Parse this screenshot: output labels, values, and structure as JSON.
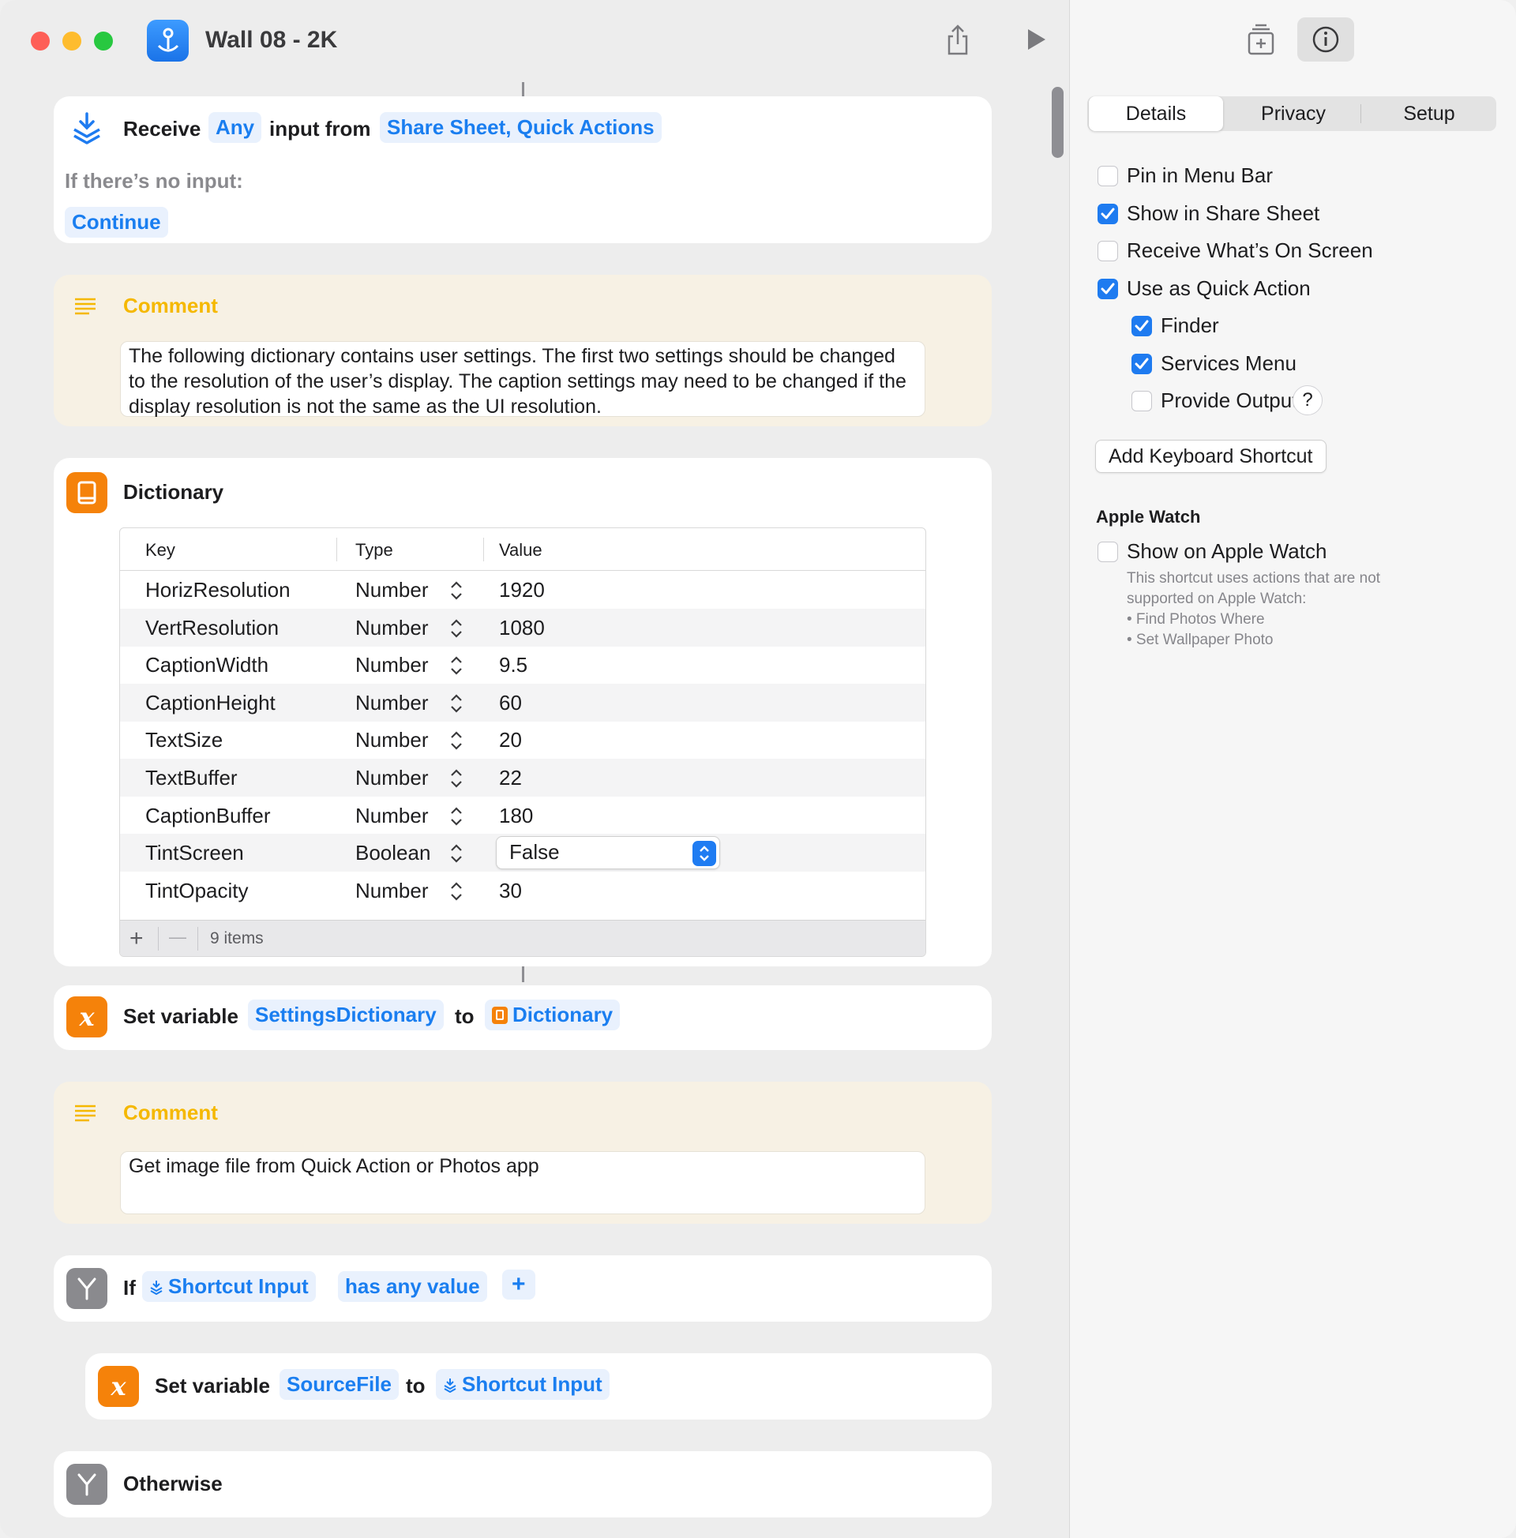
{
  "window": {
    "title": "Wall 08 - 2K",
    "icons": {
      "app": "shortcut-app-icon",
      "share": "share-icon",
      "run": "play-icon",
      "library": "add-to-library-icon",
      "info": "info-icon"
    }
  },
  "receive": {
    "label": "Receive",
    "input_type": "Any",
    "middle": "input from",
    "sources": "Share Sheet, Quick Actions",
    "no_input_label": "If there’s no input:",
    "no_input_action": "Continue"
  },
  "comment1": {
    "title": "Comment",
    "text": "The following dictionary contains user settings. The first two settings should be changed to the resolution of the user’s display. The caption settings may need to be changed if the display resolution is not the same as the UI resolution."
  },
  "dictionary": {
    "title": "Dictionary",
    "columns": {
      "key": "Key",
      "type": "Type",
      "value": "Value"
    },
    "rows": [
      {
        "key": "HorizResolution",
        "type": "Number",
        "value": "1920"
      },
      {
        "key": "VertResolution",
        "type": "Number",
        "value": "1080"
      },
      {
        "key": "CaptionWidth",
        "type": "Number",
        "value": "9.5"
      },
      {
        "key": "CaptionHeight",
        "type": "Number",
        "value": "60"
      },
      {
        "key": "TextSize",
        "type": "Number",
        "value": "20"
      },
      {
        "key": "TextBuffer",
        "type": "Number",
        "value": "22"
      },
      {
        "key": "CaptionBuffer",
        "type": "Number",
        "value": "180"
      },
      {
        "key": "TintScreen",
        "type": "Boolean",
        "value": "False"
      },
      {
        "key": "TintOpacity",
        "type": "Number",
        "value": "30"
      }
    ],
    "footer": {
      "add": "+",
      "remove": "—",
      "count": "9 items"
    }
  },
  "set_variable1": {
    "label": "Set variable",
    "variable": "SettingsDictionary",
    "to": "to",
    "value": "Dictionary"
  },
  "comment2": {
    "title": "Comment",
    "text": "Get image file from Quick Action or Photos app"
  },
  "if_block": {
    "label": "If",
    "input": "Shortcut Input",
    "condition": "has any value",
    "add": "+"
  },
  "set_variable2": {
    "label": "Set variable",
    "variable": "SourceFile",
    "to": "to",
    "value": "Shortcut Input"
  },
  "otherwise": {
    "label": "Otherwise"
  },
  "sidebar": {
    "tabs": [
      "Details",
      "Privacy",
      "Setup"
    ],
    "active_tab": "Details",
    "options": [
      {
        "label": "Pin in Menu Bar",
        "checked": false
      },
      {
        "label": "Show in Share Sheet",
        "checked": true
      },
      {
        "label": "Receive What’s On Screen",
        "checked": false
      },
      {
        "label": "Use as Quick Action",
        "checked": true
      }
    ],
    "quick_action_options": [
      {
        "label": "Finder",
        "checked": true
      },
      {
        "label": "Services Menu",
        "checked": true
      },
      {
        "label": "Provide Output",
        "checked": false
      }
    ],
    "help": "?",
    "keyboard_button": "Add Keyboard Shortcut",
    "watch_heading": "Apple Watch",
    "watch_option": {
      "label": "Show on Apple Watch",
      "checked": false
    },
    "watch_note": [
      "This shortcut uses actions that are not",
      "supported on Apple Watch:",
      "• Find Photos Where",
      "• Set Wallpaper Photo"
    ]
  },
  "colors": {
    "accent": "#1e7bf0",
    "comment_title": "#f5b800",
    "dictionary_icon": "#f5820a",
    "variable_icon": "#f5820a",
    "if_icon": "#8a8a8e"
  }
}
